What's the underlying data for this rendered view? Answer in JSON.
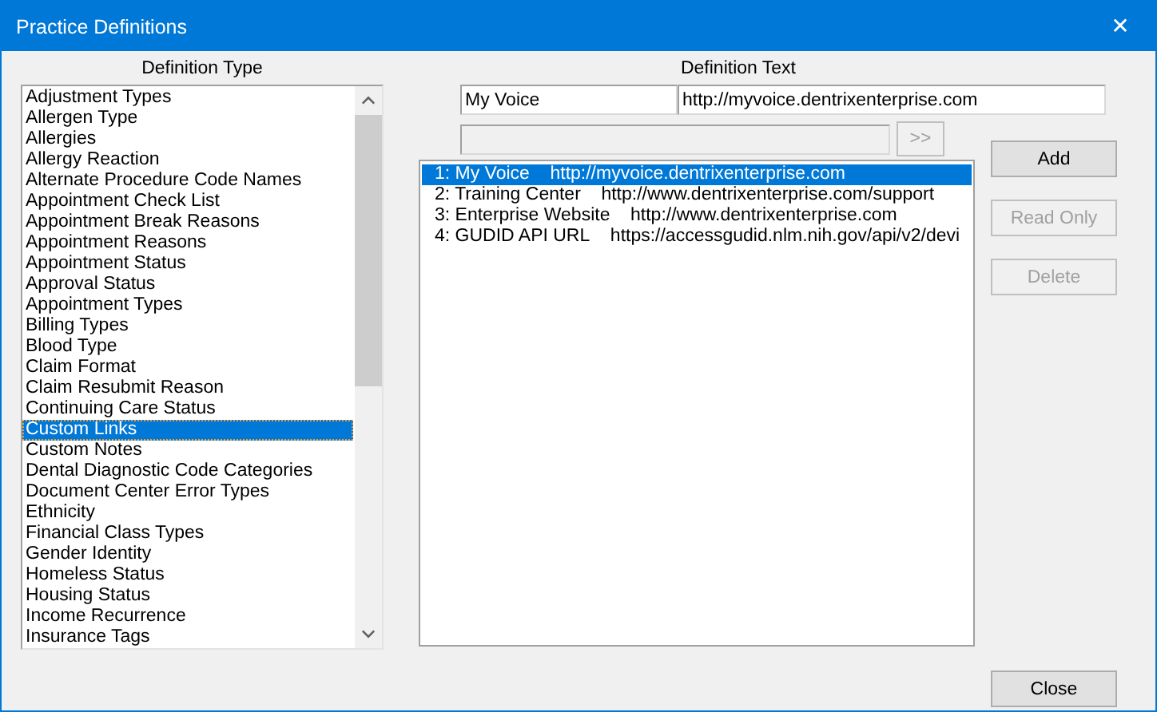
{
  "window": {
    "title": "Practice Definitions",
    "close": "✕"
  },
  "definition_type": {
    "label": "Definition Type",
    "items": [
      {
        "label": "Adjustment Types",
        "selected": false
      },
      {
        "label": "Allergen Type",
        "selected": false
      },
      {
        "label": "Allergies",
        "selected": false
      },
      {
        "label": "Allergy Reaction",
        "selected": false
      },
      {
        "label": "Alternate Procedure Code Names",
        "selected": false
      },
      {
        "label": "Appointment Check List",
        "selected": false
      },
      {
        "label": "Appointment Break Reasons",
        "selected": false
      },
      {
        "label": "Appointment Reasons",
        "selected": false
      },
      {
        "label": "Appointment Status",
        "selected": false
      },
      {
        "label": "Approval Status",
        "selected": false
      },
      {
        "label": "Appointment Types",
        "selected": false
      },
      {
        "label": "Billing Types",
        "selected": false
      },
      {
        "label": "Blood Type",
        "selected": false
      },
      {
        "label": "Claim Format",
        "selected": false
      },
      {
        "label": "Claim Resubmit Reason",
        "selected": false
      },
      {
        "label": "Continuing Care Status",
        "selected": false
      },
      {
        "label": "Custom Links",
        "selected": true
      },
      {
        "label": "Custom Notes",
        "selected": false
      },
      {
        "label": "Dental Diagnostic Code Categories",
        "selected": false
      },
      {
        "label": "Document Center Error Types",
        "selected": false
      },
      {
        "label": "Ethnicity",
        "selected": false
      },
      {
        "label": "Financial Class Types",
        "selected": false
      },
      {
        "label": "Gender Identity",
        "selected": false
      },
      {
        "label": "Homeless Status",
        "selected": false
      },
      {
        "label": "Housing Status",
        "selected": false
      },
      {
        "label": "Income Recurrence",
        "selected": false
      },
      {
        "label": "Insurance Tags",
        "selected": false
      }
    ]
  },
  "definition_text": {
    "label": "Definition Text",
    "name_value": "My Voice",
    "url_value": "http://myvoice.dentrixenterprise.com",
    "move_button": {
      "label": ">>",
      "disabled": true
    },
    "items": [
      {
        "number": "1:",
        "name": "My Voice",
        "url": "http://myvoice.dentrixenterprise.com",
        "selected": true
      },
      {
        "number": "2:",
        "name": "Training Center",
        "url": "http://www.dentrixenterprise.com/support",
        "selected": false
      },
      {
        "number": "3:",
        "name": "Enterprise Website",
        "url": "http://www.dentrixenterprise.com",
        "selected": false
      },
      {
        "number": "4:",
        "name": "GUDID API URL",
        "url": "https://accessgudid.nlm.nih.gov/api/v2/devi",
        "selected": false
      }
    ]
  },
  "buttons": [
    {
      "label": "Add",
      "disabled": false
    },
    {
      "label": "Read Only",
      "disabled": true
    },
    {
      "label": "Delete",
      "disabled": true
    }
  ],
  "close_button": {
    "label": "Close",
    "disabled": false
  }
}
